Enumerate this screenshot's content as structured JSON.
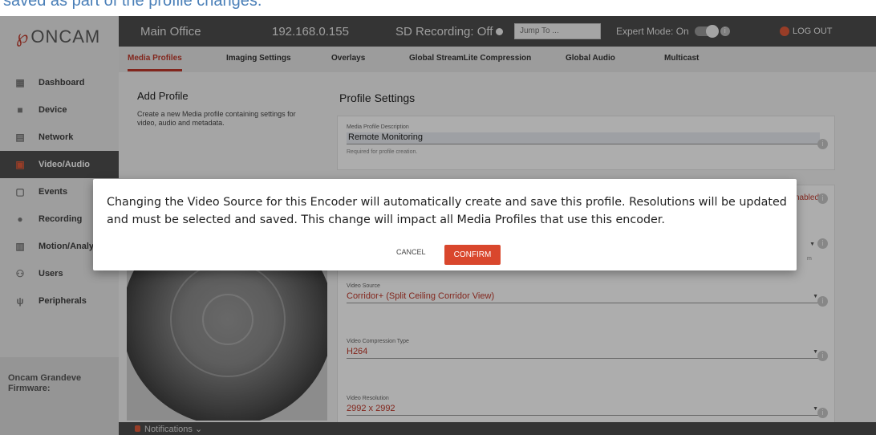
{
  "top_caption": "saved as part of the profile changes.",
  "sidebar": {
    "logo_text": "ONCAM",
    "items": [
      {
        "label": "Dashboard",
        "icon": "grid-icon"
      },
      {
        "label": "Device",
        "icon": "camera-icon"
      },
      {
        "label": "Network",
        "icon": "server-icon"
      },
      {
        "label": "Video/Audio",
        "icon": "video-icon",
        "active": true
      },
      {
        "label": "Events",
        "icon": "calendar-icon"
      },
      {
        "label": "Recording",
        "icon": "record-icon"
      },
      {
        "label": "Motion/Analyt",
        "icon": "chart-icon"
      },
      {
        "label": "Users",
        "icon": "user-icon"
      },
      {
        "label": "Peripherals",
        "icon": "usb-icon"
      }
    ],
    "footer_line1": "Oncam Grandeve",
    "footer_line2": "Firmware:"
  },
  "header": {
    "site": "Main Office",
    "ip": "192.168.0.155",
    "sd": "SD Recording: Off",
    "jump_placeholder": "Jump To ...",
    "expert": "Expert Mode: On",
    "logout": "LOG OUT"
  },
  "tabs": [
    "Media Profiles",
    "Imaging Settings",
    "Overlays",
    "Global StreamLite Compression",
    "Global Audio",
    "Multicast"
  ],
  "main": {
    "add_title": "Add Profile",
    "add_desc": "Create a new Media profile containing settings for video, audio and metadata.",
    "settings_title": "Profile Settings",
    "desc_label": "Media Profile Description",
    "desc_value": "Remote Monitoring",
    "desc_help": "Required for profile creation.",
    "enabled_text": "nabled",
    "truncated_help": "m",
    "source_label": "Video Source",
    "source_value": "Corridor+ (Split Ceiling Corridor View)",
    "compression_label": "Video Compression Type",
    "compression_value": "H264",
    "resolution_label": "Video Resolution",
    "resolution_value": "2992 x 2992"
  },
  "bottom": {
    "notifications": "Notifications ⌄"
  },
  "dialog": {
    "message": "Changing the Video Source for this Encoder will automatically create and save this profile. Resolutions will be updated and must be selected and saved. This change will impact all Media Profiles that use this encoder.",
    "cancel": "CANCEL",
    "confirm": "CONFIRM"
  },
  "colors": {
    "accent": "#c0392b",
    "header_bg": "#4d4d4d",
    "confirm_bg": "#d9472d"
  }
}
